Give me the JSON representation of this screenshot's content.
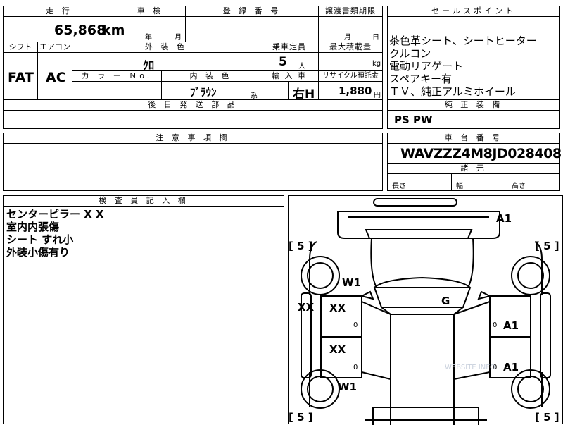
{
  "top": {
    "mileage_label": "走 行",
    "mileage_value": "65,868",
    "mileage_unit": "km",
    "inspection_label": "車 検",
    "inspection_year": "年",
    "inspection_month": "月",
    "registration_label": "登 録 番 号",
    "transfer_label": "譲渡書類期限",
    "transfer_month": "月",
    "transfer_day": "日"
  },
  "row2": {
    "shift_label": "シフト",
    "aircon_label": "エアコン",
    "exterior_label": "外 装 色",
    "capacity_label": "乗車定員",
    "maxload_label": "最大積載量",
    "shift_value": "FAT",
    "aircon_value": "AC",
    "exterior_value": "ｸﾛ",
    "capacity_value": "5",
    "capacity_unit": "人",
    "maxload_unit": "kg",
    "color_no_label": "カ ラ ー Ｎo.",
    "interior_label": "内 装 色",
    "import_label": "輸 入 車",
    "recycle_label": "リサイクル預託金",
    "interior_value": "ﾌﾞﾗｳﾝ",
    "interior_suffix": "系",
    "import_value": "右H",
    "recycle_value": "1,880",
    "recycle_unit": "円"
  },
  "delivery_label": "後 日 発 送 部 品",
  "notes_label": "注 意 事 項 欄",
  "sales": {
    "label": "セールスポイント",
    "items": [
      "茶色革シート、シートヒーター",
      "クルコン",
      "電動リアゲート",
      "スペアキー有",
      "ＴＶ、純正アルミホイール"
    ]
  },
  "genuine": {
    "label": "純 正 装 備",
    "value": "PS PW"
  },
  "chassis": {
    "label": "車 台 番 号",
    "value": "WAVZZZ4M8JD028408"
  },
  "dimensions": {
    "label": "諸 元",
    "length": "長さ",
    "width": "幅",
    "height": "高さ"
  },
  "inspector": {
    "label": "検 査 員 記 入 欄",
    "lines": [
      "センターピラー X X",
      "室内内張傷",
      "シート すれ小",
      "外装小傷有り"
    ]
  },
  "diagram": {
    "marks": {
      "a1_top": "A1",
      "w1_upper": "W1",
      "g": "G",
      "xx_left": "XX",
      "xx_door_front": "XX",
      "a1_right_front": "A1",
      "xx_door_rear": "XX",
      "a1_right_rear": "A1",
      "w1_lower": "W1"
    },
    "tire_marks": {
      "front_left": "[ 5 ]",
      "front_right": "[ 5 ]",
      "rear_left": "[ 5 ]",
      "rear_right": "[ 5 ]"
    },
    "watermark": "WEBSITE INFO"
  }
}
